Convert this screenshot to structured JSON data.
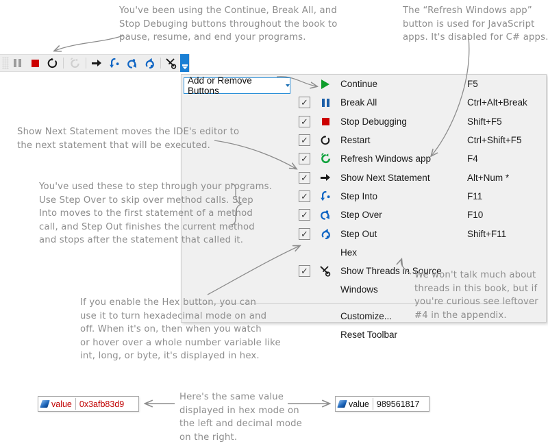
{
  "toolbar": {
    "name": "debug-toolbar",
    "buttons": [
      {
        "name": "pause-icon",
        "label": "Break All",
        "state": "disabled"
      },
      {
        "name": "stop-icon",
        "label": "Stop Debugging",
        "state": "enabled"
      },
      {
        "name": "restart-icon",
        "label": "Restart",
        "state": "enabled"
      },
      {
        "name": "refresh-windows-app-icon",
        "label": "Refresh Windows app",
        "state": "disabled"
      },
      {
        "name": "show-next-statement-icon",
        "label": "Show Next Statement",
        "state": "enabled"
      },
      {
        "name": "step-into-icon",
        "label": "Step Into",
        "state": "enabled"
      },
      {
        "name": "step-over-icon",
        "label": "Step Over",
        "state": "enabled"
      },
      {
        "name": "step-out-icon",
        "label": "Step Out",
        "state": "enabled"
      },
      {
        "name": "show-threads-in-source-icon",
        "label": "Show Threads in Source",
        "state": "enabled"
      }
    ],
    "overflow_label": "Toolbar Options"
  },
  "menu": {
    "header_label": "Add or Remove Buttons",
    "items": [
      {
        "label": "Continue",
        "shortcut": "F5",
        "checked": false,
        "icon": "play-icon",
        "has_icon": true
      },
      {
        "label": "Break All",
        "shortcut": "Ctrl+Alt+Break",
        "checked": true,
        "icon": "pause-icon",
        "has_icon": true
      },
      {
        "label": "Stop Debugging",
        "shortcut": "Shift+F5",
        "checked": true,
        "icon": "stop-icon",
        "has_icon": true
      },
      {
        "label": "Restart",
        "shortcut": "Ctrl+Shift+F5",
        "checked": true,
        "icon": "restart-icon",
        "has_icon": true
      },
      {
        "label": "Refresh Windows app",
        "shortcut": "F4",
        "checked": true,
        "icon": "refresh-windows-app-icon",
        "has_icon": true
      },
      {
        "label": "Show Next Statement",
        "shortcut": "Alt+Num *",
        "checked": true,
        "icon": "show-next-statement-icon",
        "has_icon": true
      },
      {
        "label": "Step Into",
        "shortcut": "F11",
        "checked": true,
        "icon": "step-into-icon",
        "has_icon": true
      },
      {
        "label": "Step Over",
        "shortcut": "F10",
        "checked": true,
        "icon": "step-over-icon",
        "has_icon": true
      },
      {
        "label": "Step Out",
        "shortcut": "Shift+F11",
        "checked": true,
        "icon": "step-out-icon",
        "has_icon": true
      },
      {
        "label": "Hex",
        "shortcut": "",
        "checked": false,
        "icon": "",
        "has_icon": false
      },
      {
        "label": "Show Threads in Source",
        "shortcut": "",
        "checked": true,
        "icon": "show-threads-icon",
        "has_icon": true
      },
      {
        "label": "Windows",
        "shortcut": "",
        "checked": false,
        "icon": "",
        "has_icon": false
      }
    ],
    "footer_items": [
      {
        "label": "Customize..."
      },
      {
        "label": "Reset Toolbar"
      }
    ]
  },
  "annotations": {
    "top_left": "You've been using the Continue, Break All, and\nStop Debuging buttons throughout the book to\npause, resume, and end your programs.",
    "top_right": "The “Refresh Windows app”\nbutton is used for JavaScript\napps. It's disabled for C# apps.",
    "show_next_statement": "Show Next Statement moves the IDE's editor to\nthe next statement that will be executed.",
    "stepping": "You've used these to step through your programs.\nUse Step Over to skip over method calls. Step\nInto moves to the first statement of a method\ncall, and Step Out finishes the current method\nand stops after the statement that called it.",
    "hex": "If you enable the Hex button, you can\nuse it to turn hexadecimal mode on and\noff. When it's on, then when you watch\nor hover over a whole number variable like\nint, long, or byte, it's displayed in hex.",
    "threads": "We won't talk much about\nthreads in this book, but if\nyou're curious see leftover\n#4 in the appendix.",
    "values": "Here's the same value\ndisplayed in hex mode on\nthe left and decimal mode\non the right."
  },
  "values": {
    "hex": {
      "name": "value",
      "value": "0x3afb83d9"
    },
    "decimal": {
      "name": "value",
      "value": "989561817"
    }
  },
  "colors": {
    "accent_blue": "#1a7fd4",
    "continue_green": "#0f9d2b",
    "stop_red": "#cc0000",
    "step_blue": "#1166c4",
    "handwriting_gray": "#8d8d8d"
  }
}
